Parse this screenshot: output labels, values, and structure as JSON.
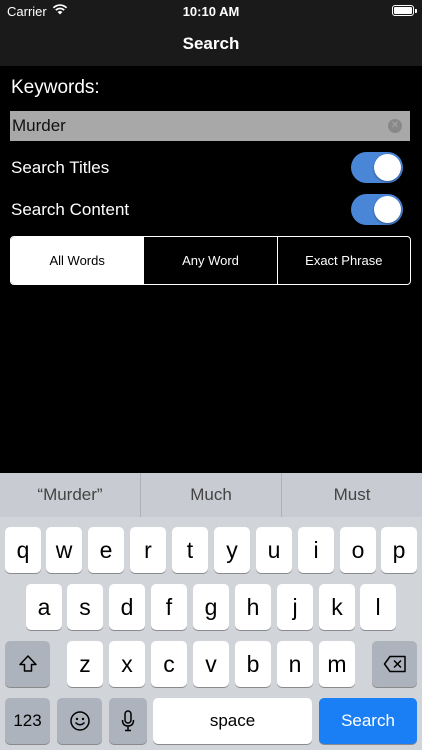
{
  "status_bar": {
    "carrier": "Carrier",
    "time": "10:10 AM"
  },
  "nav": {
    "title": "Search"
  },
  "form": {
    "keywords_label": "Keywords:",
    "search_value": "Murder",
    "search_titles_label": "Search Titles",
    "search_titles_on": true,
    "search_content_label": "Search Content",
    "search_content_on": true,
    "segments": [
      "All Words",
      "Any Word",
      "Exact Phrase"
    ],
    "selected_segment": "All Words"
  },
  "keyboard": {
    "suggestions": [
      "“Murder”",
      "Much",
      "Must"
    ],
    "row1": [
      "q",
      "w",
      "e",
      "r",
      "t",
      "y",
      "u",
      "i",
      "o",
      "p"
    ],
    "row2": [
      "a",
      "s",
      "d",
      "f",
      "g",
      "h",
      "j",
      "k",
      "l"
    ],
    "row3": [
      "z",
      "x",
      "c",
      "v",
      "b",
      "n",
      "m"
    ],
    "numbers_key": "123",
    "space_key": "space",
    "search_key": "Search"
  },
  "colors": {
    "accent": "#1a7ff5",
    "toggle_on": "#4a86d8"
  }
}
